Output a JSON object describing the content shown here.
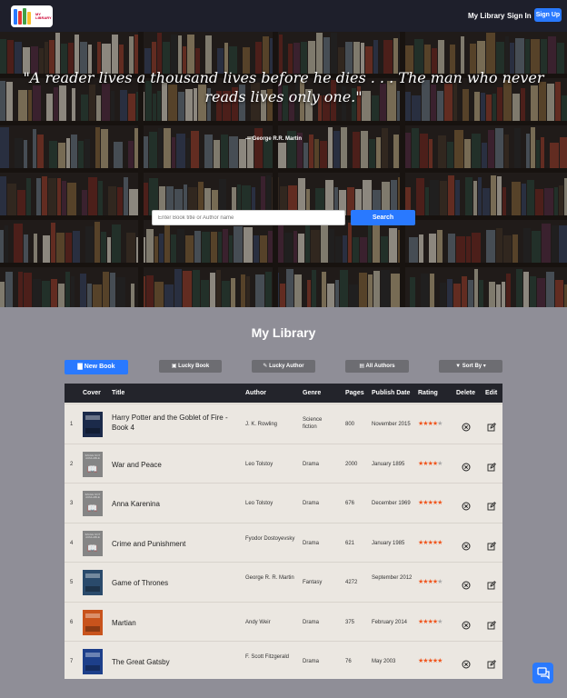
{
  "nav": {
    "logo_text": "MY LIBRARY",
    "my_library": "My Library",
    "sign_in": "Sign In",
    "sign_up": "Sign Up"
  },
  "hero": {
    "quote": "\"A reader lives a thousand lives before he dies . . . The man who never reads lives only one.\"",
    "author": "— George R.R. Martin",
    "search_placeholder": "Enter Book title or Author name",
    "search_button": "Search"
  },
  "library": {
    "title": "My Library",
    "toolbar": {
      "new_book": "New Book",
      "lucky_book": "Lucky Book",
      "lucky_author": "Lucky Author",
      "all_authors": "All Authors",
      "sort_by": "Sort By"
    },
    "columns": [
      "Cover",
      "Title",
      "Author",
      "Genre",
      "Pages",
      "Publish Date",
      "Rating",
      "Delete",
      "Edit"
    ],
    "cover_placeholder": "IMAGE NOT AVAILABLE",
    "rows": [
      {
        "num": "1",
        "title": "Harry Potter and the Goblet of Fire - Book 4",
        "author": "J. K. Rowling",
        "genre": "Science fiction",
        "pages": "800",
        "date": "November 2015",
        "rating": 4,
        "cover": "image",
        "cover_color": "#1b2a4a"
      },
      {
        "num": "2",
        "title": "War and Peace",
        "author": "Leo Tolstoy",
        "genre": "Drama",
        "pages": "2000",
        "date": "January 1895",
        "rating": 4,
        "cover": "na",
        "cover_color": "#858585"
      },
      {
        "num": "3",
        "title": "Anna Karenina",
        "author": "Leo Tolstoy",
        "genre": "Drama",
        "pages": "676",
        "date": "December 1969",
        "rating": 5,
        "cover": "na",
        "cover_color": "#858585"
      },
      {
        "num": "4",
        "title": "Crime and Punishment",
        "author": "Fyodor Dostoyevsky",
        "genre": "Drama",
        "pages": "621",
        "date": "January 1985",
        "rating": 5,
        "cover": "na",
        "cover_color": "#858585"
      },
      {
        "num": "5",
        "title": "Game of Thrones",
        "author": "George R. R. Martin",
        "genre": "Fantasy",
        "pages": "4272",
        "date": "September 2012",
        "rating": 4,
        "cover": "image",
        "cover_color": "#2a4a6b"
      },
      {
        "num": "6",
        "title": "Martian",
        "author": "Andy Weir",
        "genre": "Drama",
        "pages": "375",
        "date": "February 2014",
        "rating": 4,
        "cover": "image",
        "cover_color": "#c8531c"
      },
      {
        "num": "7",
        "title": "The Great Gatsby",
        "author": "F. Scott Fitzgerald",
        "genre": "Drama",
        "pages": "76",
        "date": "May 2003",
        "rating": 5,
        "cover": "image",
        "cover_color": "#1d3f8a"
      }
    ]
  },
  "colors": {
    "accent": "#2979ff",
    "star": "#f0561e",
    "navbar": "#1e1f2b",
    "page_bg": "#8f8e97"
  }
}
